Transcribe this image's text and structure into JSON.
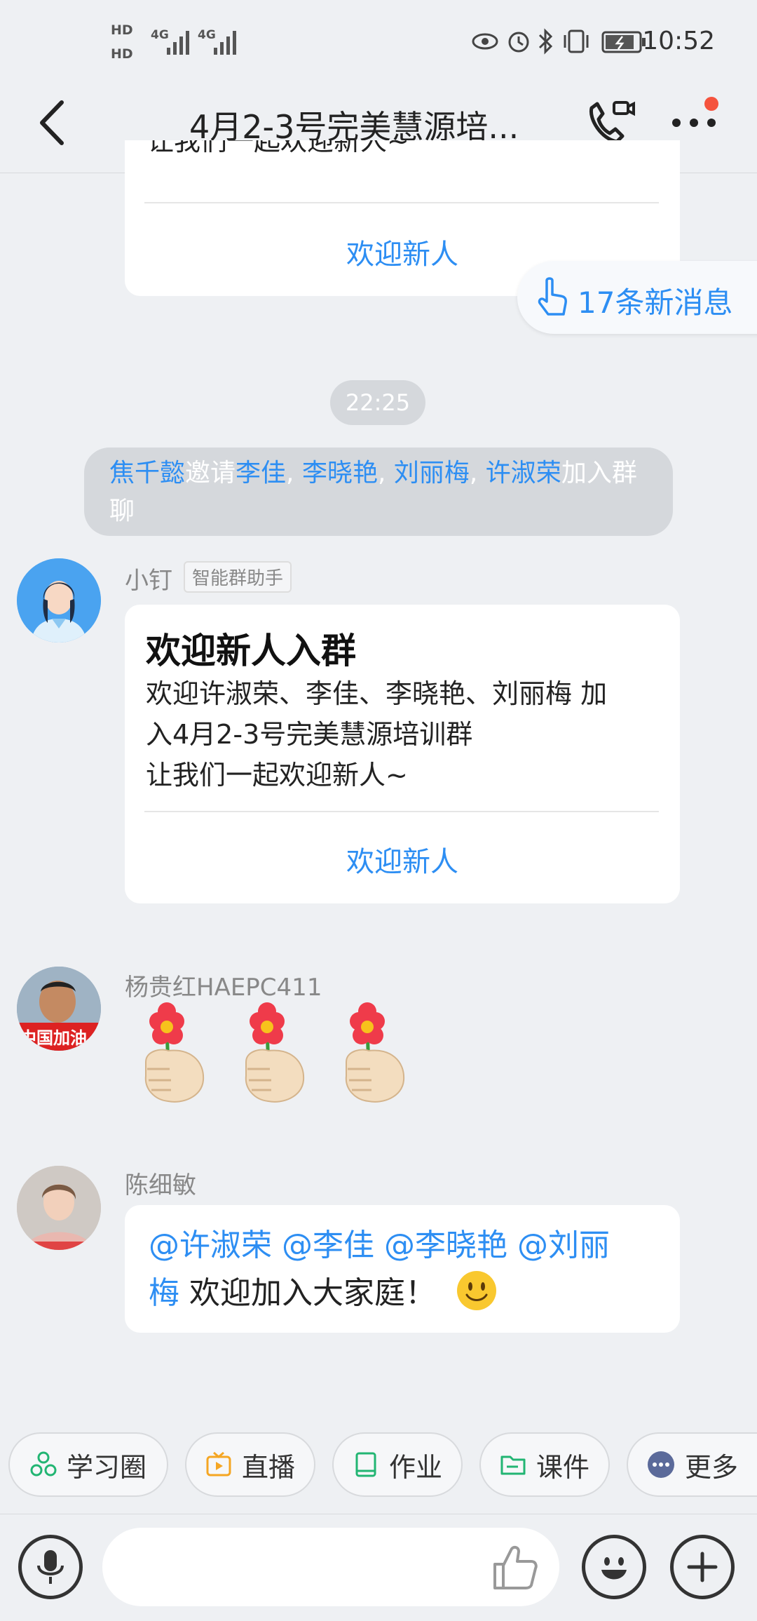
{
  "status": {
    "hd1": "HD",
    "hd2": "HD",
    "net1": "4G",
    "net2": "4G",
    "time": "10:52"
  },
  "header": {
    "title": "4月2-3号完美慧源培...",
    "back_icon": "chevron-left-icon",
    "call_icon": "phone-video-icon",
    "more_icon": "more-icon",
    "notify_dot_color": "#f5533d"
  },
  "new_messages": {
    "label": "17条新消息",
    "icon": "hand-point-icon"
  },
  "top_card": {
    "partial_text": "让我们一起欢迎新人~",
    "button": "欢迎新人"
  },
  "timestamp": "22:25",
  "system_message": {
    "inviter": "焦千懿",
    "invite_word": "邀请",
    "invitees": [
      "李佳",
      "李晓艳",
      "刘丽梅",
      "许淑荣"
    ],
    "sep": ",",
    "suffix": "加入群聊"
  },
  "messages": [
    {
      "sender": "小钉",
      "tag": "智能群助手",
      "card_title": "欢迎新人入群",
      "card_body_line1": "欢迎许淑荣、李佳、李晓艳、刘丽梅 加",
      "card_body_line2": "入4月2-3号完美慧源培训群",
      "card_body_line3": "让我们一起欢迎新人~",
      "card_button": "欢迎新人"
    },
    {
      "sender": "杨贵红HAEPC411",
      "avatar_text": "中国加油",
      "content": "flower-emoji-x3"
    },
    {
      "sender": "陈细敏",
      "mentions": "@许淑荣 @李佳 @李晓艳 @刘丽",
      "mention_tail": "梅",
      "text": " 欢迎加入大家庭！"
    }
  ],
  "quick_bar": [
    {
      "label": "学习圈",
      "icon": "circles-icon",
      "color": "#22b573"
    },
    {
      "label": "直播",
      "icon": "tv-icon",
      "color": "#f5a623"
    },
    {
      "label": "作业",
      "icon": "book-icon",
      "color": "#22b573"
    },
    {
      "label": "课件",
      "icon": "folder-icon",
      "color": "#22b573"
    },
    {
      "label": "更多",
      "icon": "more-dots-icon",
      "color": "#5b6a9a"
    }
  ],
  "input": {
    "placeholder": ""
  },
  "colors": {
    "accent": "#2d8ef3",
    "background": "#eef0f3"
  }
}
